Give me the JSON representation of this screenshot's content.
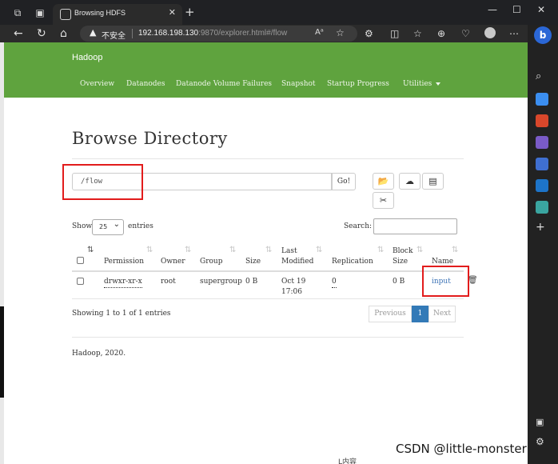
{
  "browser": {
    "tab_title": "Browsing HDFS",
    "tab_close": "✕",
    "new_tab": "+",
    "security_label": "不安全",
    "url_host": "192.168.198.130",
    "url_path": ":9870/explorer.html#/flow",
    "read_aloud": "Aᵃ",
    "window_minimize": "—",
    "window_maximize": "☐",
    "window_close": "✕",
    "bing_label": "b"
  },
  "navbar": {
    "brand": "Hadoop",
    "links": [
      "Overview",
      "Datanodes",
      "Datanode Volume Failures",
      "Snapshot",
      "Startup Progress",
      "Utilities"
    ]
  },
  "main": {
    "title": "Browse Directory",
    "path_value": "/flow",
    "go_label": "Go!",
    "show_label": "Show",
    "page_size": "25",
    "entries_label": "entries",
    "search_label": "Search:",
    "table": {
      "headers": [
        "Permission",
        "Owner",
        "Group",
        "Size",
        "Last Modified",
        "Replication",
        "Block Size",
        "Name"
      ],
      "header_lines": {
        "last_modified": [
          "Last",
          "Modified"
        ],
        "block_size": [
          "Block",
          "Size"
        ]
      },
      "rows": [
        {
          "permission": "drwxr-xr-x",
          "owner": "root",
          "group": "supergroup",
          "size": "0 B",
          "modified_date": "Oct 19",
          "modified_time": "17:06",
          "replication": "0",
          "block_size": "0 B",
          "name": "input"
        }
      ]
    },
    "info": "Showing 1 to 1 of 1 entries",
    "pagination": {
      "previous": "Previous",
      "current": "1",
      "next": "Next"
    }
  },
  "footer": {
    "text": "Hadoop, 2020."
  },
  "overlay": {
    "watermark": "CSDN @little-monster",
    "bottom_text": "L内容"
  },
  "colors": {
    "navbar": "#5fa33e",
    "highlight": "#e21c1c",
    "link": "#3b72b5",
    "active_page": "#337ab7"
  }
}
